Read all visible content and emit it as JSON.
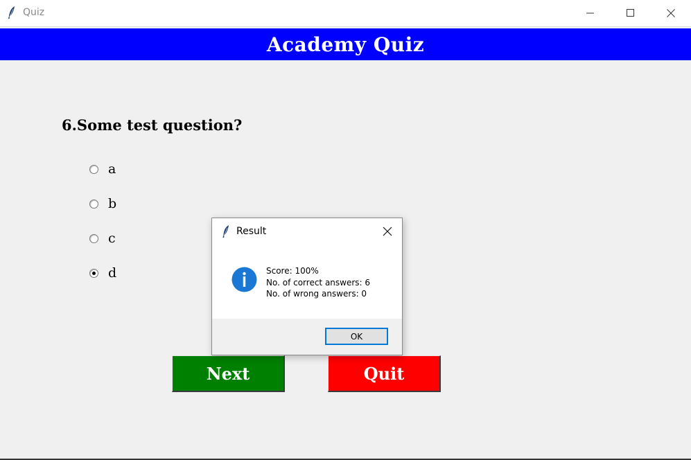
{
  "window": {
    "title": "Quiz",
    "icon": "feather-icon",
    "controls": [
      "minimize-icon",
      "maximize-icon",
      "close-icon"
    ]
  },
  "header": {
    "title": "Academy Quiz",
    "background": "#0000ff"
  },
  "question": {
    "text": "6.Some test question?"
  },
  "options": [
    {
      "label": "a",
      "selected": false
    },
    {
      "label": "b",
      "selected": false
    },
    {
      "label": "c",
      "selected": false
    },
    {
      "label": "d",
      "selected": true
    }
  ],
  "buttons": {
    "next": {
      "label": "Next",
      "color": "#008000"
    },
    "quit": {
      "label": "Quit",
      "color": "#ff0000"
    }
  },
  "dialog": {
    "title": "Result",
    "icon": "info-icon",
    "lines": [
      "Score: 100%",
      "No. of correct answers: 6",
      "No. of wrong answers: 0"
    ],
    "ok_label": "OK"
  }
}
